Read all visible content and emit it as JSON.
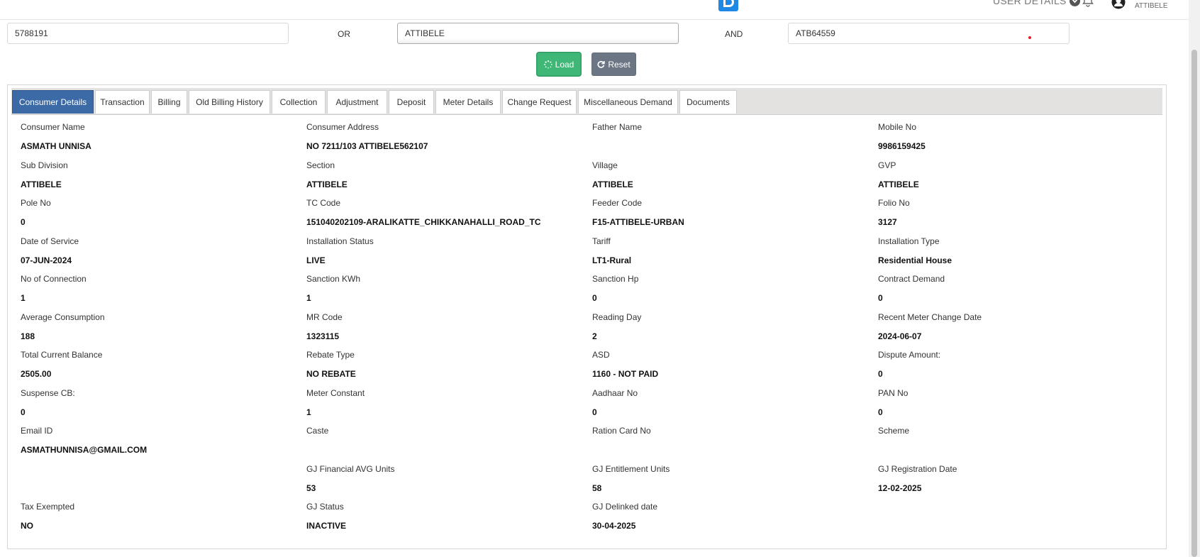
{
  "header": {
    "user_details_label": "USER DETAILS",
    "user_location": "ATTIBELE"
  },
  "search": {
    "field1_value": "5788191",
    "conj1": "OR",
    "field2_value": "ATTIBELE",
    "conj2": "AND",
    "field3_value": "ATB64559",
    "load_label": "Load",
    "reset_label": "Reset"
  },
  "tabs": [
    {
      "label": "Consumer Details"
    },
    {
      "label": "Transaction"
    },
    {
      "label": "Billing"
    },
    {
      "label": "Old Billing History"
    },
    {
      "label": "Collection"
    },
    {
      "label": "Adjustment"
    },
    {
      "label": "Deposit"
    },
    {
      "label": "Meter Details"
    },
    {
      "label": "Change Request"
    },
    {
      "label": "Miscellaneous Demand"
    },
    {
      "label": "Documents"
    }
  ],
  "details": [
    [
      {
        "label": "Consumer Name",
        "value": "ASMATH UNNISA"
      },
      {
        "label": "Consumer Address",
        "value": "NO 7211/103 ATTIBELE562107"
      },
      {
        "label": "Father Name",
        "value": ""
      },
      {
        "label": "Mobile No",
        "value": "9986159425"
      }
    ],
    [
      {
        "label": "Sub Division",
        "value": "ATTIBELE"
      },
      {
        "label": "Section",
        "value": "ATTIBELE"
      },
      {
        "label": "Village",
        "value": "ATTIBELE"
      },
      {
        "label": "GVP",
        "value": "ATTIBELE"
      }
    ],
    [
      {
        "label": "Pole No",
        "value": "0"
      },
      {
        "label": "TC Code",
        "value": "151040202109-ARALIKATTE_CHIKKANAHALLI_ROAD_TC"
      },
      {
        "label": "Feeder Code",
        "value": "F15-ATTIBELE-URBAN"
      },
      {
        "label": "Folio No",
        "value": "3127"
      }
    ],
    [
      {
        "label": "Date of Service",
        "value": "07-JUN-2024"
      },
      {
        "label": "Installation Status",
        "value": "LIVE"
      },
      {
        "label": "Tariff",
        "value": "LT1-Rural"
      },
      {
        "label": "Installation Type",
        "value": "Residential House"
      }
    ],
    [
      {
        "label": "No of Connection",
        "value": "1"
      },
      {
        "label": "Sanction KWh",
        "value": "1"
      },
      {
        "label": "Sanction Hp",
        "value": "0"
      },
      {
        "label": "Contract Demand",
        "value": "0"
      }
    ],
    [
      {
        "label": "Average Consumption",
        "value": "188"
      },
      {
        "label": "MR Code",
        "value": "1323115"
      },
      {
        "label": "Reading Day",
        "value": "2"
      },
      {
        "label": "Recent Meter Change Date",
        "value": "2024-06-07"
      }
    ],
    [
      {
        "label": "Total Current Balance",
        "value": "2505.00"
      },
      {
        "label": "Rebate Type",
        "value": "NO REBATE"
      },
      {
        "label": "ASD",
        "value": "1160 - NOT PAID"
      },
      {
        "label": "Dispute Amount:",
        "value": "0"
      }
    ],
    [
      {
        "label": "Suspense CB:",
        "value": "0"
      },
      {
        "label": "Meter Constant",
        "value": "1"
      },
      {
        "label": "Aadhaar No",
        "value": "0"
      },
      {
        "label": "PAN No",
        "value": "0"
      }
    ],
    [
      {
        "label": "Email ID",
        "value": "ASMATHUNNISA@GMAIL.COM"
      },
      {
        "label": "Caste",
        "value": ""
      },
      {
        "label": "Ration Card No",
        "value": ""
      },
      {
        "label": "Scheme",
        "value": ""
      }
    ],
    [
      {
        "label": "",
        "value": ""
      },
      {
        "label": "GJ Financial AVG Units",
        "value": "53"
      },
      {
        "label": "GJ Entitlement Units",
        "value": "58"
      },
      {
        "label": "GJ Registration Date",
        "value": "12-02-2025"
      }
    ],
    [
      {
        "label": "Tax Exempted",
        "value": "NO"
      },
      {
        "label": "GJ Status",
        "value": "INACTIVE"
      },
      {
        "label": "GJ Delinked date",
        "value": "30-04-2025"
      },
      {
        "label": "",
        "value": ""
      }
    ]
  ],
  "colors": {
    "load": "#3fb877",
    "reset": "#6c7584",
    "active_tab": "#3c6aa6",
    "logo": "#1e88e5"
  }
}
